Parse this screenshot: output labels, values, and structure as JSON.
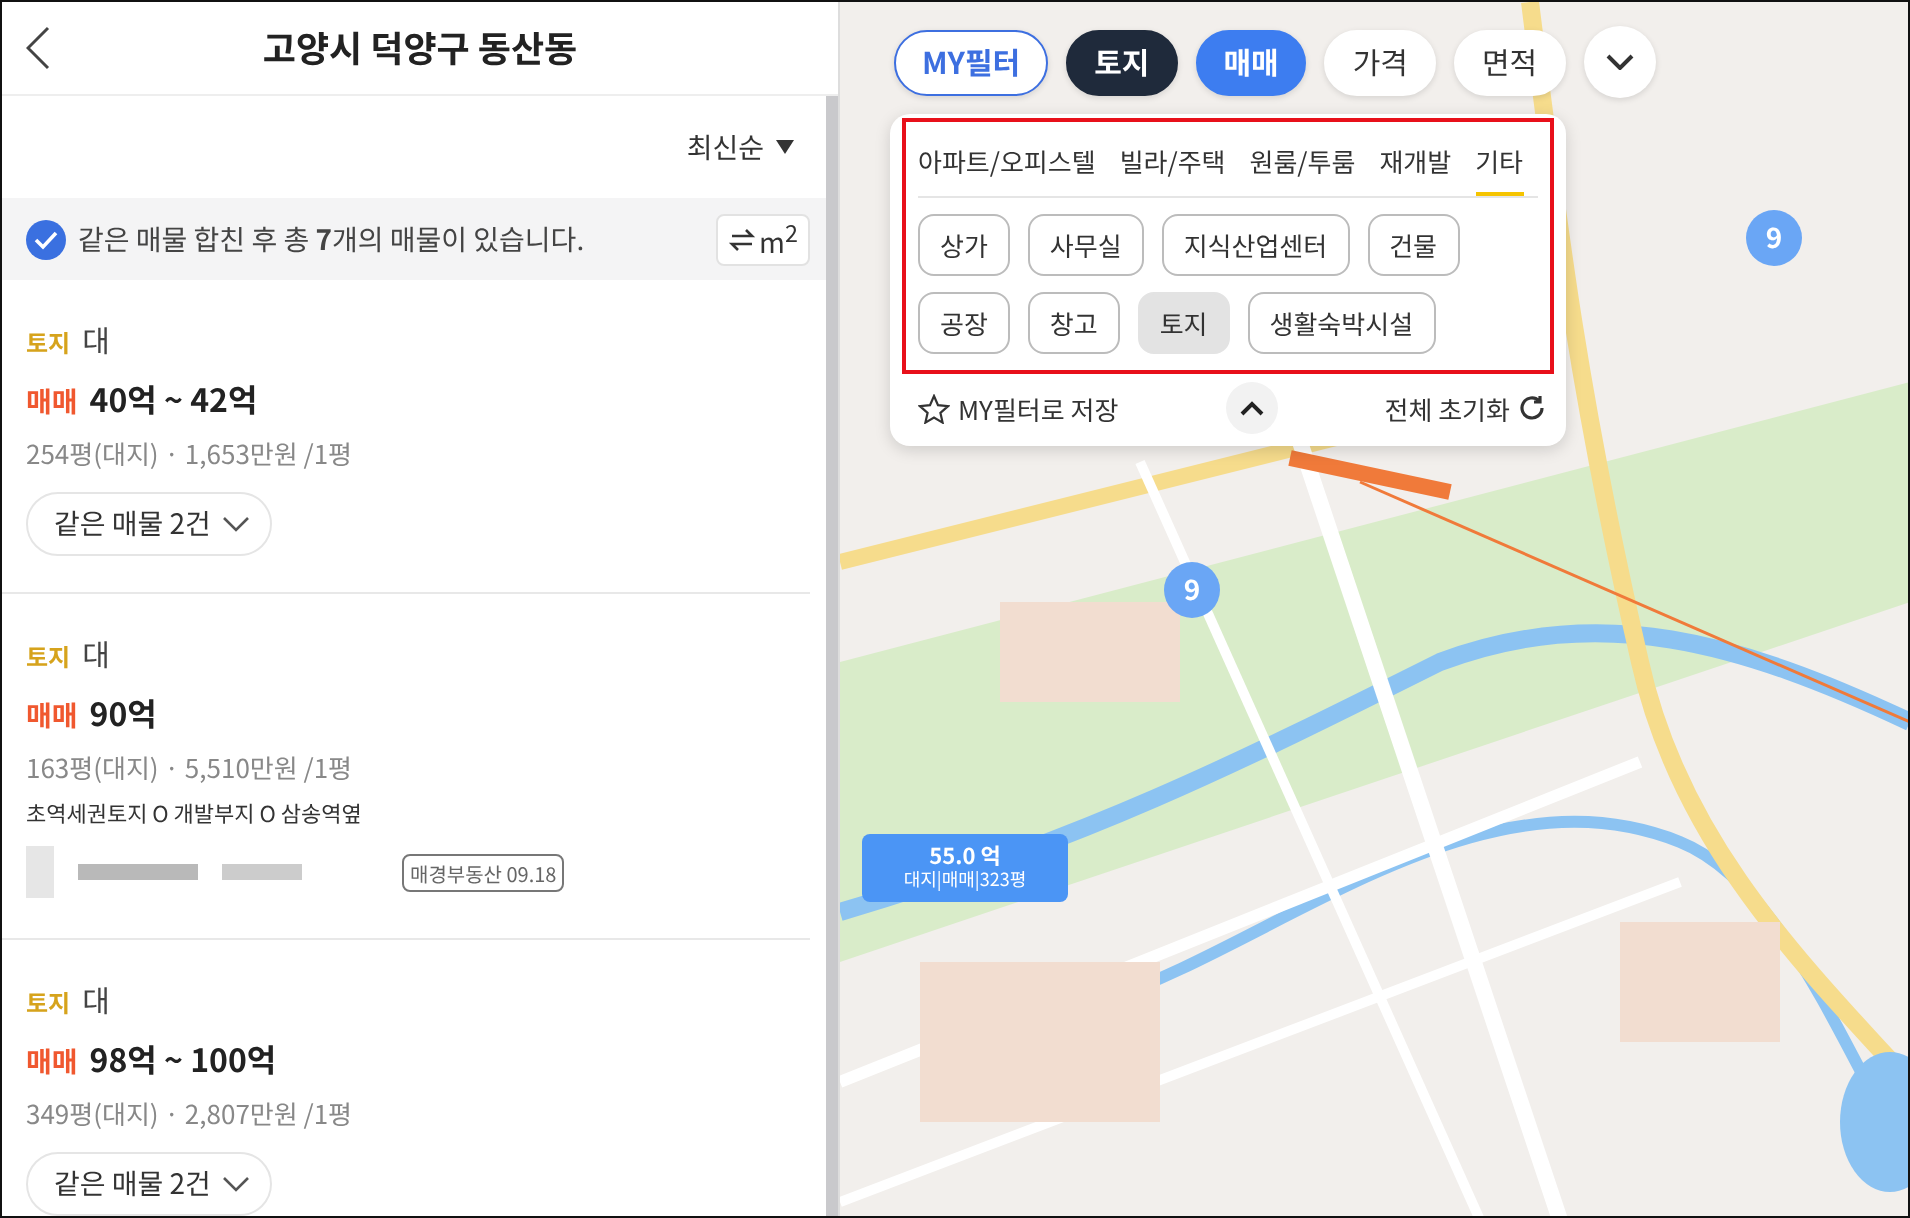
{
  "header": {
    "title": "고양시 덕양구 동산동"
  },
  "sort": {
    "label": "최신순"
  },
  "notice": {
    "checked": true,
    "text": "같은 매물 합친 후 총 **7**개의 매물이 있습니다.",
    "unit_label": "m$^{2}$"
  },
  "listings": [
    {
      "type": "토지",
      "subtype": "대",
      "deal": "매매",
      "price": "40억 ~ 42억",
      "area": "254평(대지) · 1,653만원 /1평",
      "same_button": "같은 매물 2건"
    },
    {
      "type": "토지",
      "subtype": "대",
      "deal": "매매",
      "price": "90억",
      "area": "163평(대지) · 5,510만원 /1평",
      "description": "초역세권토지 O 개발부지 O 삼송역옆",
      "agency": "매경부동산 09.18"
    },
    {
      "type": "토지",
      "subtype": "대",
      "deal": "매매",
      "price": "98억 ~ 100억",
      "area": "349평(대지) · 2,807만원 /1평",
      "same_button": "같은 매물 2건"
    }
  ],
  "filters": [
    {
      "label": "MY필터",
      "kind": "outline"
    },
    {
      "label": "토지",
      "kind": "dark"
    },
    {
      "label": "매매",
      "kind": "blue"
    },
    {
      "label": "가격",
      "kind": "plain"
    },
    {
      "label": "면적",
      "kind": "plain"
    }
  ],
  "filter_panel": {
    "expanded": true,
    "tabs": [
      {
        "label": "아파트/오피스텔",
        "selected": false
      },
      {
        "label": "빌라/주택",
        "selected": false
      },
      {
        "label": "원룸/투룸",
        "selected": false
      },
      {
        "label": "재개발",
        "selected": false
      },
      {
        "label": "기타",
        "selected": true
      }
    ],
    "chip_rows": [
      [
        {
          "label": "상가",
          "selected": false
        },
        {
          "label": "사무실",
          "selected": false
        },
        {
          "label": "지식산업센터",
          "selected": false
        },
        {
          "label": "건물",
          "selected": false
        }
      ],
      [
        {
          "label": "공장",
          "selected": false
        },
        {
          "label": "창고",
          "selected": false
        },
        {
          "label": "토지",
          "selected": true
        },
        {
          "label": "생활숙박시설",
          "selected": false
        }
      ]
    ],
    "save_label": "MY필터로 저장",
    "reset_label": "전체 초기화"
  },
  "map": {
    "clusters": [
      {
        "count": "9"
      },
      {
        "count": "9"
      }
    ],
    "price_marker": {
      "price": "55.0 억",
      "detail": "대지|매매|323평"
    }
  }
}
